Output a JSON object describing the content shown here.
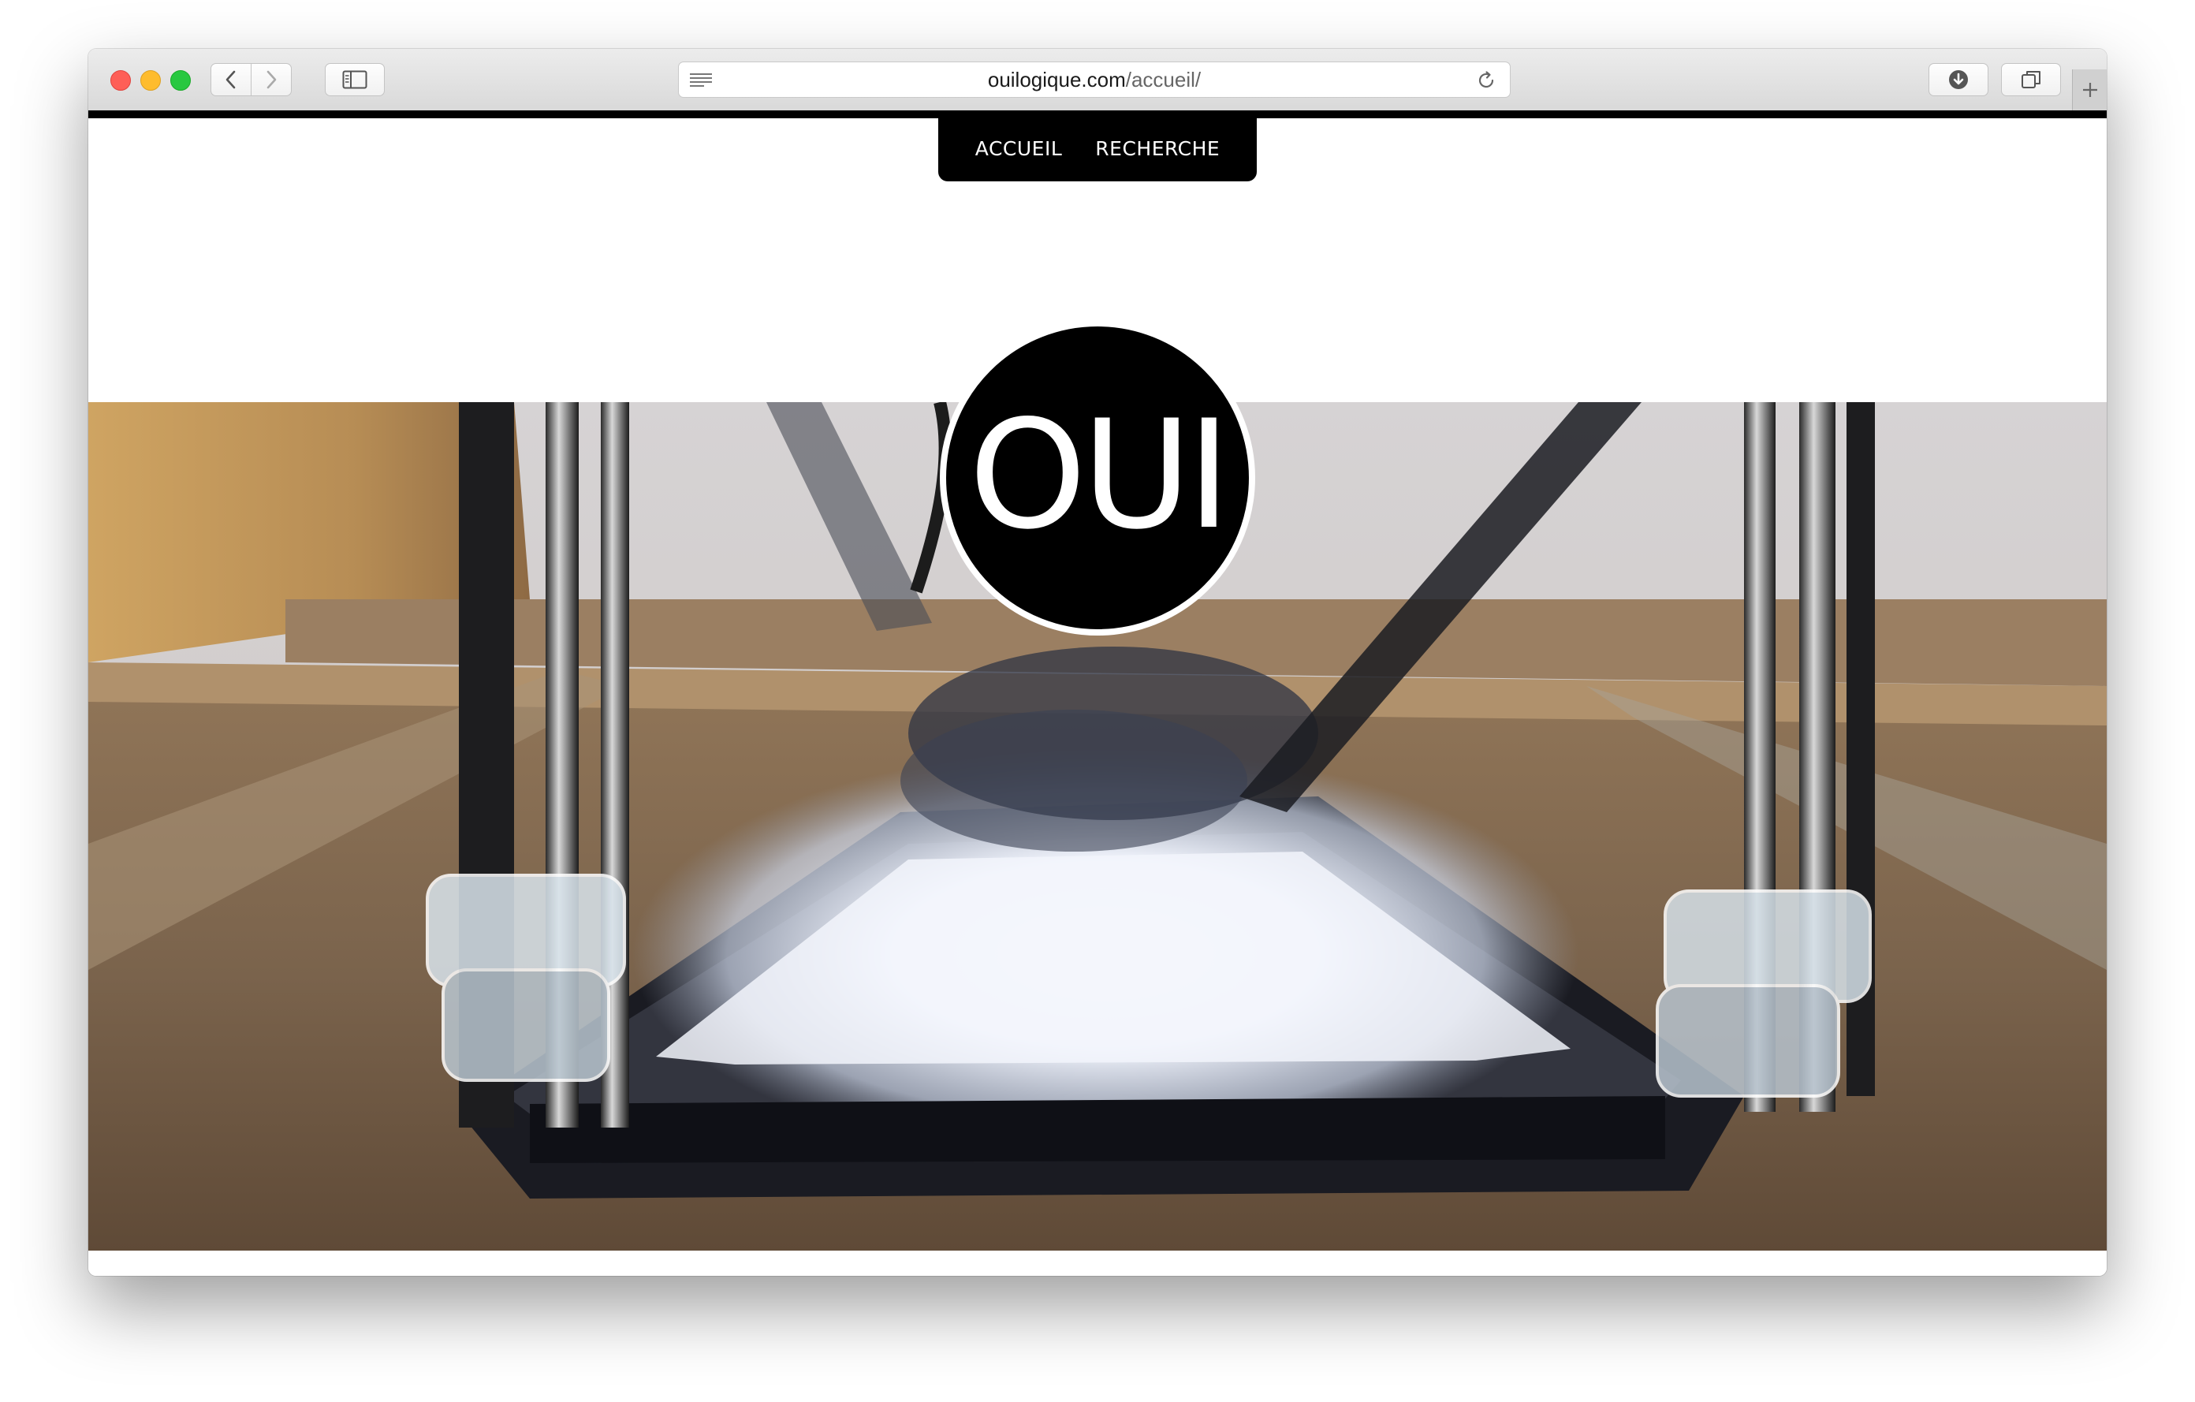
{
  "browser": {
    "url_domain": "ouilogique.com",
    "url_path": "/accueil/",
    "icons": {
      "back": "chevron-left-icon",
      "forward": "chevron-right-icon",
      "sidebar": "sidebar-icon",
      "reader": "reader-mode-icon",
      "reload": "reload-icon",
      "download": "download-icon",
      "tabs": "tab-overview-icon",
      "new_tab": "plus-icon"
    }
  },
  "site": {
    "nav": [
      {
        "label": "ACCUEIL"
      },
      {
        "label": "RECHERCHE"
      }
    ],
    "logo_text": "OUI"
  },
  "colors": {
    "nav_background": "#000000",
    "nav_text": "#ffffff",
    "logo_background": "#000000",
    "logo_border": "#ffffff"
  },
  "hero": {
    "subject": "delta 3D printer with illuminated glass bed"
  }
}
